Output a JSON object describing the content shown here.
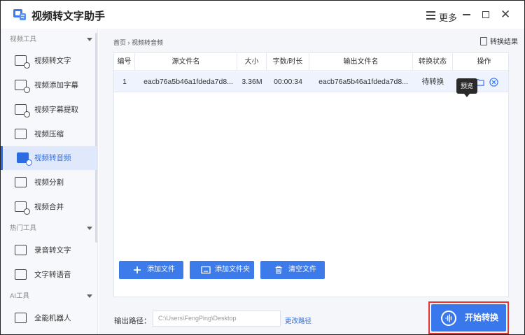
{
  "app": {
    "title": "视频转文字助手",
    "menu_label": "更多"
  },
  "sidebar": {
    "sections": [
      {
        "label": "视频工具",
        "items": [
          "视频转文字",
          "视频添加字幕",
          "视频字幕提取",
          "视频压缩",
          "视频转音频",
          "视频分割",
          "视频合并"
        ]
      },
      {
        "label": "热门工具",
        "items": [
          "录音转文字",
          "文字转语音"
        ]
      },
      {
        "label": "AI工具",
        "items": [
          "全能机器人"
        ]
      }
    ],
    "active_item": "视频转音频"
  },
  "main": {
    "breadcrumb": "首页 › 视频转音频",
    "result_link": "转换结果",
    "table": {
      "headers": [
        "编号",
        "源文件名",
        "大小",
        "字数/时长",
        "输出文件名",
        "转换状态",
        "操作"
      ],
      "rows": [
        {
          "index": "1",
          "source": "eacb76a5b46a1fdeda7d8...",
          "size": "3.36M",
          "duration": "00:00:34",
          "output": "eacb76a5b46a1fdeda7d8...",
          "status": "待转换"
        }
      ]
    },
    "tooltip": "预览",
    "buttons": {
      "add_file": "添加文件",
      "add_folder": "添加文件夹",
      "clear": "清空文件"
    },
    "output": {
      "label": "输出路径：",
      "path": "C:\\Users\\FengPing\\Desktop",
      "change": "更改路径"
    },
    "start_button": "开始转换"
  },
  "colors": {
    "accent": "#3e7bea",
    "highlight_border": "#e23636",
    "active_bg": "#dfe9fb"
  }
}
